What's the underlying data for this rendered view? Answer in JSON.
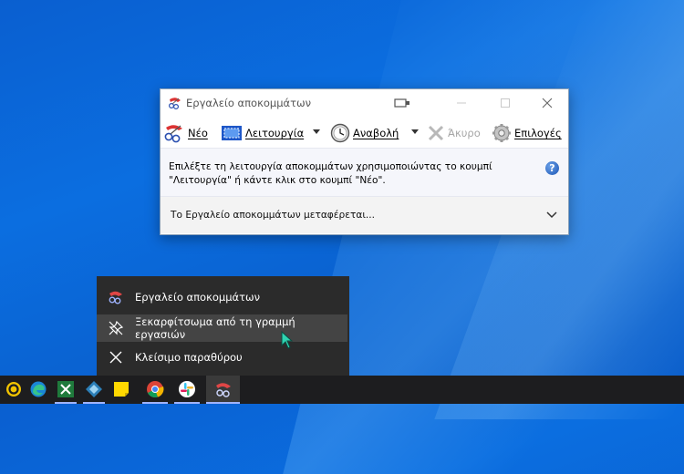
{
  "window": {
    "title": "Εργαλείο αποκομμάτων",
    "toolbar": {
      "new_label": "Νέο",
      "mode_label": "Λειτουργία",
      "delay_label": "Αναβολή",
      "cancel_label": "Άκυρο",
      "options_label": "Επιλογές"
    },
    "message": "Επιλέξτε τη λειτουργία αποκομμάτων χρησιμοποιώντας το κουμπί \"Λειτουργία\" ή κάντε κλικ στο κουμπί \"Νέο\".",
    "help_glyph": "?",
    "notice": "Το Εργαλείο αποκομμάτων μεταφέρεται..."
  },
  "jump_list": {
    "items": [
      {
        "label": "Εργαλείο αποκομμάτων",
        "icon": "snipping-tool-icon"
      },
      {
        "label": "Ξεκαρφίτσωμα από τη γραμμή εργασιών",
        "icon": "unpin-icon"
      },
      {
        "label": "Κλείσιμο παραθύρου",
        "icon": "close-icon"
      }
    ]
  },
  "taskbar": {
    "apps": [
      "cortana-icon",
      "edge-icon",
      "excel-icon",
      "kodi-icon",
      "sticky-notes-icon",
      "chrome-icon",
      "slack-icon",
      "snipping-tool-icon"
    ]
  },
  "colors": {
    "desktop": "#0a63d2",
    "jump_bg": "#2b2b2b",
    "jump_hover": "#444444",
    "taskbar": "#1d1d1f"
  }
}
